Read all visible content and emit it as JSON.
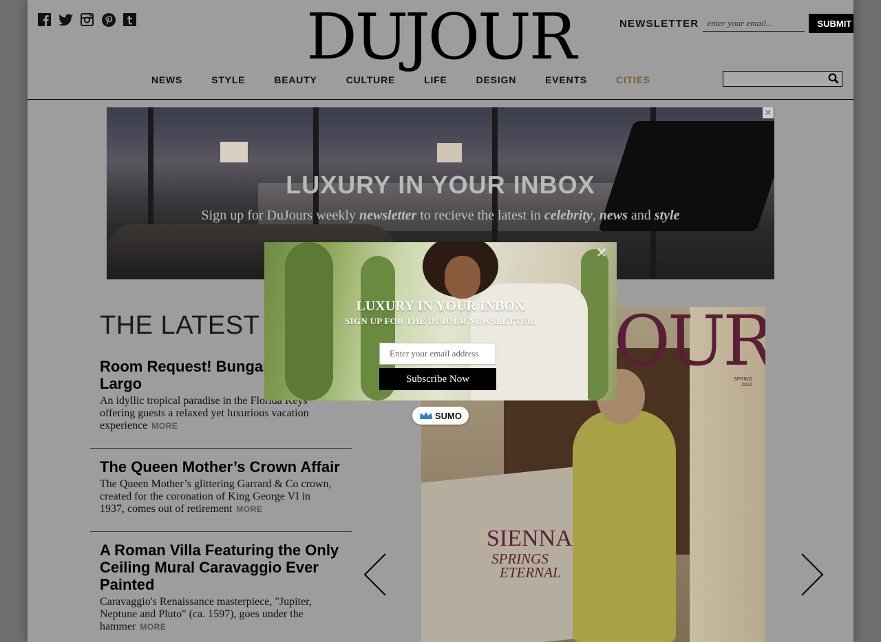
{
  "header": {
    "logo": "DUJOUR",
    "social": [
      "facebook-icon",
      "twitter-icon",
      "instagram-icon",
      "pinterest-icon",
      "tumblr-icon"
    ],
    "newsletter_label": "NEWSLETTER",
    "newsletter_placeholder": "enter your email...",
    "submit_label": "SUBMIT"
  },
  "nav": {
    "items": [
      {
        "label": "NEWS"
      },
      {
        "label": "STYLE"
      },
      {
        "label": "BEAUTY"
      },
      {
        "label": "CULTURE"
      },
      {
        "label": "LIFE"
      },
      {
        "label": "DESIGN"
      },
      {
        "label": "EVENTS"
      },
      {
        "label": "CITIES"
      }
    ],
    "active_color": "#7a6232"
  },
  "banner": {
    "title": "LUXURY IN YOUR INBOX",
    "sub_prefix": "Sign up for DuJours weekly",
    "sub_word1": "newsletter",
    "sub_middle": "to recieve the latest in",
    "sub_word2": "celebrity",
    "sub_word3": "news",
    "sub_and": "and",
    "sub_word4": "style",
    "close_label": "✕"
  },
  "latest": {
    "title": "THE LATEST",
    "more_label": "MORE",
    "articles": [
      {
        "title": "Room Request! Bungalows Key Largo",
        "excerpt": "An idyllic tropical paradise in the Florida Keys offering guests a relaxed yet luxurious vacation experience"
      },
      {
        "title": "The Queen Mother’s Crown Affair",
        "excerpt": "The Queen Mother’s glittering Garrard & Co crown, created for the coronation of King George VI in 1937, comes out of retirement"
      },
      {
        "title": "A Roman Villa Featuring the Only Ceiling Mural Caravaggio Ever Painted",
        "excerpt": "Caravaggio's Renaissance masterpiece, \"Jupiter, Neptune and Pluto\" (ca. 1597), goes under the hammer"
      }
    ]
  },
  "magazine": {
    "logo_fragment": "OUR",
    "edition_line1": "SPRING",
    "edition_line2": "2022",
    "cover_name": "SIENNA",
    "cover_tag_line1": "SPRINGS",
    "cover_tag_line2": "ETERNAL"
  },
  "popup": {
    "title": "LUXURY IN YOUR INBOX",
    "subtitle": "SIGN UP FOR THE DUJOUR NEWSLETTER.",
    "email_placeholder": "Enter your email address",
    "button_label": "Subscribe Now",
    "close_label": "✕",
    "badge_label": "SUMO"
  }
}
